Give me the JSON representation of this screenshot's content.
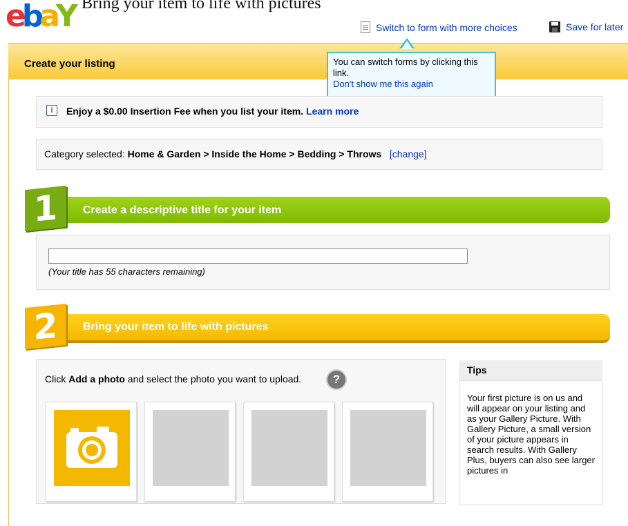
{
  "top": {
    "clipped_text": "Bring your item to life with pictures",
    "logo": {
      "e": "e",
      "b": "b",
      "a": "a",
      "y": "Y"
    },
    "switch_link": "Switch to form with more choices",
    "save_link": "Save for later"
  },
  "header": {
    "title": "Create your listing"
  },
  "tooltip": {
    "text": "You can switch forms by clicking this link.",
    "dismiss": "Don't show me this again"
  },
  "fee": {
    "info_icon": "i",
    "text": "Enjoy a $0.00 Insertion Fee when you list your item.",
    "learn_more": "Learn more"
  },
  "category": {
    "label": "Category selected:",
    "path": "Home & Garden > Inside the Home > Bedding > Throws",
    "change": "change"
  },
  "step1": {
    "number": "1",
    "title": "Create a descriptive title for your item",
    "input_value": "",
    "hint": "(Your title has 55 characters remaining)"
  },
  "step2": {
    "number": "2",
    "title": "Bring your item to life with pictures",
    "instr_pre": "Click",
    "instr_bold": "Add a photo",
    "instr_post": "and select the photo you want to upload.",
    "help_icon": "?"
  },
  "tips": {
    "heading": "Tips",
    "text": "Your first picture is on us and will appear on your listing and as your Gallery Picture. With Gallery Picture, a small version of your picture appears in search results. With Gallery Plus, buyers can also see larger pictures in"
  },
  "colors": {
    "step1": "#7fba00",
    "step2": "#f5b800",
    "tooltip_border": "#40c4d0"
  },
  "icons": [
    "document-icon",
    "floppy-disk-icon",
    "info-icon",
    "help-icon",
    "camera-icon"
  ]
}
